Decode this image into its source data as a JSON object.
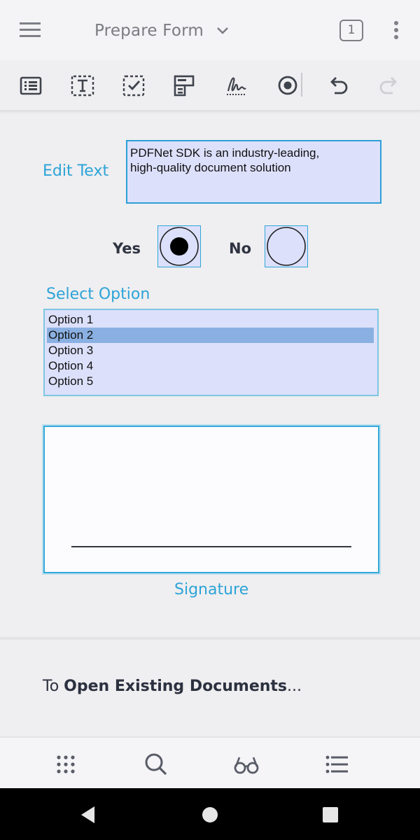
{
  "header": {
    "title": "Prepare Form",
    "page_count": "1"
  },
  "toolbar": {
    "tools": [
      {
        "name": "list-box-field-tool"
      },
      {
        "name": "text-field-tool"
      },
      {
        "name": "checkbox-field-tool"
      },
      {
        "name": "combo-box-field-tool"
      },
      {
        "name": "signature-field-tool"
      },
      {
        "name": "radio-button-field-tool"
      },
      {
        "name": "undo"
      },
      {
        "name": "redo",
        "disabled": true
      }
    ]
  },
  "form": {
    "edit_text_label": "Edit Text",
    "text_field_value_line1": "PDFNet SDK is an industry-leading,",
    "text_field_value_line2": "high-quality document solution",
    "radio": {
      "yes_label": "Yes",
      "no_label": "No",
      "selected": "Yes"
    },
    "select_label": "Select Option",
    "options": [
      "Option 1",
      "Option 2",
      "Option 3",
      "Option 4",
      "Option 5"
    ],
    "selected_option": "Option 2",
    "signature_label": "Signature"
  },
  "footer": {
    "prefix": "To ",
    "bold": "Open Existing Documents",
    "suffix": "..."
  },
  "colors": {
    "accent": "#2ca4d8",
    "field_fill": "#dce0fb",
    "selected_option": "#8ab0e2",
    "icon": "#3f434c"
  }
}
